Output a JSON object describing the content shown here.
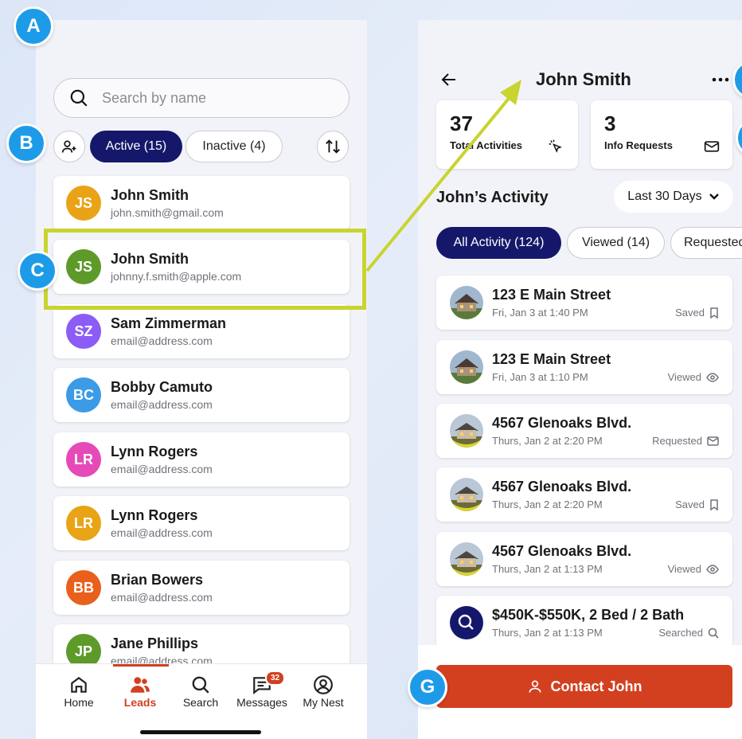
{
  "badges": {
    "a": "A",
    "b": "B",
    "c": "C",
    "g": "G"
  },
  "leads_screen": {
    "search_placeholder": "Search by name",
    "filters": {
      "active": "Active (15)",
      "inactive": "Inactive (4)"
    },
    "leads": [
      {
        "initials": "JS",
        "name": "John Smith",
        "email": "john.smith@gmail.com",
        "color": "#e8a416"
      },
      {
        "initials": "JS",
        "name": "John Smith",
        "email": "johnny.f.smith@apple.com",
        "color": "#5d9a2a"
      },
      {
        "initials": "SZ",
        "name": "Sam Zimmerman",
        "email": "email@address.com",
        "color": "#8b5cf6"
      },
      {
        "initials": "BC",
        "name": "Bobby Camuto",
        "email": "email@address.com",
        "color": "#3b9be6"
      },
      {
        "initials": "LR",
        "name": "Lynn Rogers",
        "email": "email@address.com",
        "color": "#e649b8"
      },
      {
        "initials": "LR",
        "name": "Lynn Rogers",
        "email": "email@address.com",
        "color": "#e8a416"
      },
      {
        "initials": "BB",
        "name": "Brian Bowers",
        "email": "email@address.com",
        "color": "#e8601c"
      },
      {
        "initials": "JP",
        "name": "Jane Phillips",
        "email": "email@address.com",
        "color": "#5d9a2a"
      }
    ],
    "tabs": {
      "home": "Home",
      "leads": "Leads",
      "search": "Search",
      "messages": "Messages",
      "mynest": "My Nest"
    },
    "messages_count": "32"
  },
  "detail_screen": {
    "title": "John Smith",
    "stats": {
      "total_num": "37",
      "total_label": "Total Activities",
      "info_num": "3",
      "info_label": "Info Requests"
    },
    "section_title": "John’s Activity",
    "range": "Last 30 Days",
    "tabs": {
      "all": "All Activity (124)",
      "viewed": "Viewed (14)",
      "requested": "Requested"
    },
    "activities": [
      {
        "title": "123 E Main Street",
        "date": "Fri, Jan 3 at 1:40 PM",
        "status": "Saved"
      },
      {
        "title": "123 E Main Street",
        "date": "Fri, Jan 3 at 1:10 PM",
        "status": "Viewed"
      },
      {
        "title": "4567 Glenoaks Blvd.",
        "date": "Thurs, Jan 2 at 2:20 PM",
        "status": "Requested"
      },
      {
        "title": "4567 Glenoaks Blvd.",
        "date": "Thurs, Jan 2 at 2:20 PM",
        "status": "Saved"
      },
      {
        "title": "4567 Glenoaks Blvd.",
        "date": "Thurs, Jan 2 at 1:13 PM",
        "status": "Viewed"
      },
      {
        "title": "$450K-$550K, 2 Bed / 2 Bath",
        "date": "Thurs, Jan 2 at 1:13 PM",
        "status": "Searched"
      }
    ],
    "contact_label": "Contact John"
  }
}
